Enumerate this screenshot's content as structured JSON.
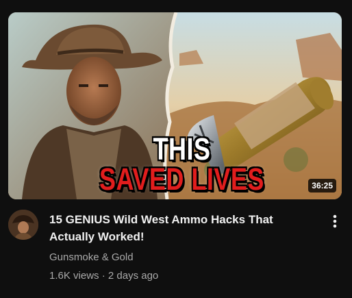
{
  "video": {
    "thumbnail_text_line1": "THIS",
    "thumbnail_text_line2": "SAVED LIVES",
    "duration": "36:25",
    "title": "15 GENIUS Wild West Ammo Hacks That Actually Worked!",
    "channel": "Gunsmoke & Gold",
    "views": "1.6K views",
    "separator": "·",
    "age": "2 days ago"
  },
  "colors": {
    "background": "#0f0f0f",
    "title_text": "#f1f1f1",
    "secondary_text": "#aaaaaa",
    "thumb_accent_red": "#e11d1d"
  },
  "icons": {
    "menu": "more-vert-icon"
  }
}
